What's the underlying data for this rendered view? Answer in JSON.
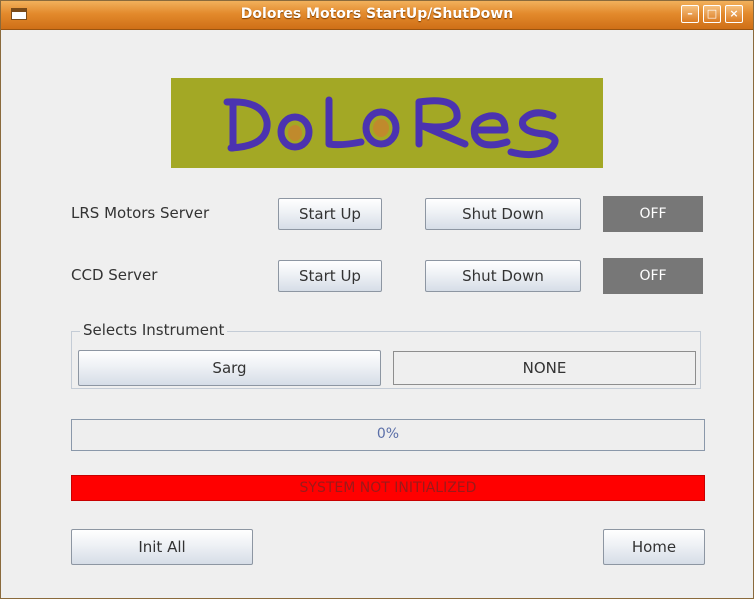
{
  "window": {
    "title": "Dolores Motors StartUp/ShutDown",
    "controls": [
      "minimize",
      "maximize",
      "close"
    ],
    "title_color": "#e38a2c"
  },
  "logo": {
    "text": "DoLoRes",
    "background": "#a3a825",
    "ink": "#4b33b0"
  },
  "servers": [
    {
      "label": "LRS Motors Server",
      "start_label": "Start Up",
      "stop_label": "Shut Down",
      "status": "OFF"
    },
    {
      "label": "CCD Server",
      "start_label": "Start Up",
      "stop_label": "Shut Down",
      "status": "OFF"
    }
  ],
  "instrument": {
    "group_title": "Selects Instrument",
    "button_label": "Sarg",
    "selected": "NONE"
  },
  "progress": {
    "value": 0,
    "text": "0%"
  },
  "system_status": {
    "text": "SYSTEM NOT INITIALIZED",
    "color": "#ff0000"
  },
  "actions": {
    "init_label": "Init All",
    "home_label": "Home"
  }
}
